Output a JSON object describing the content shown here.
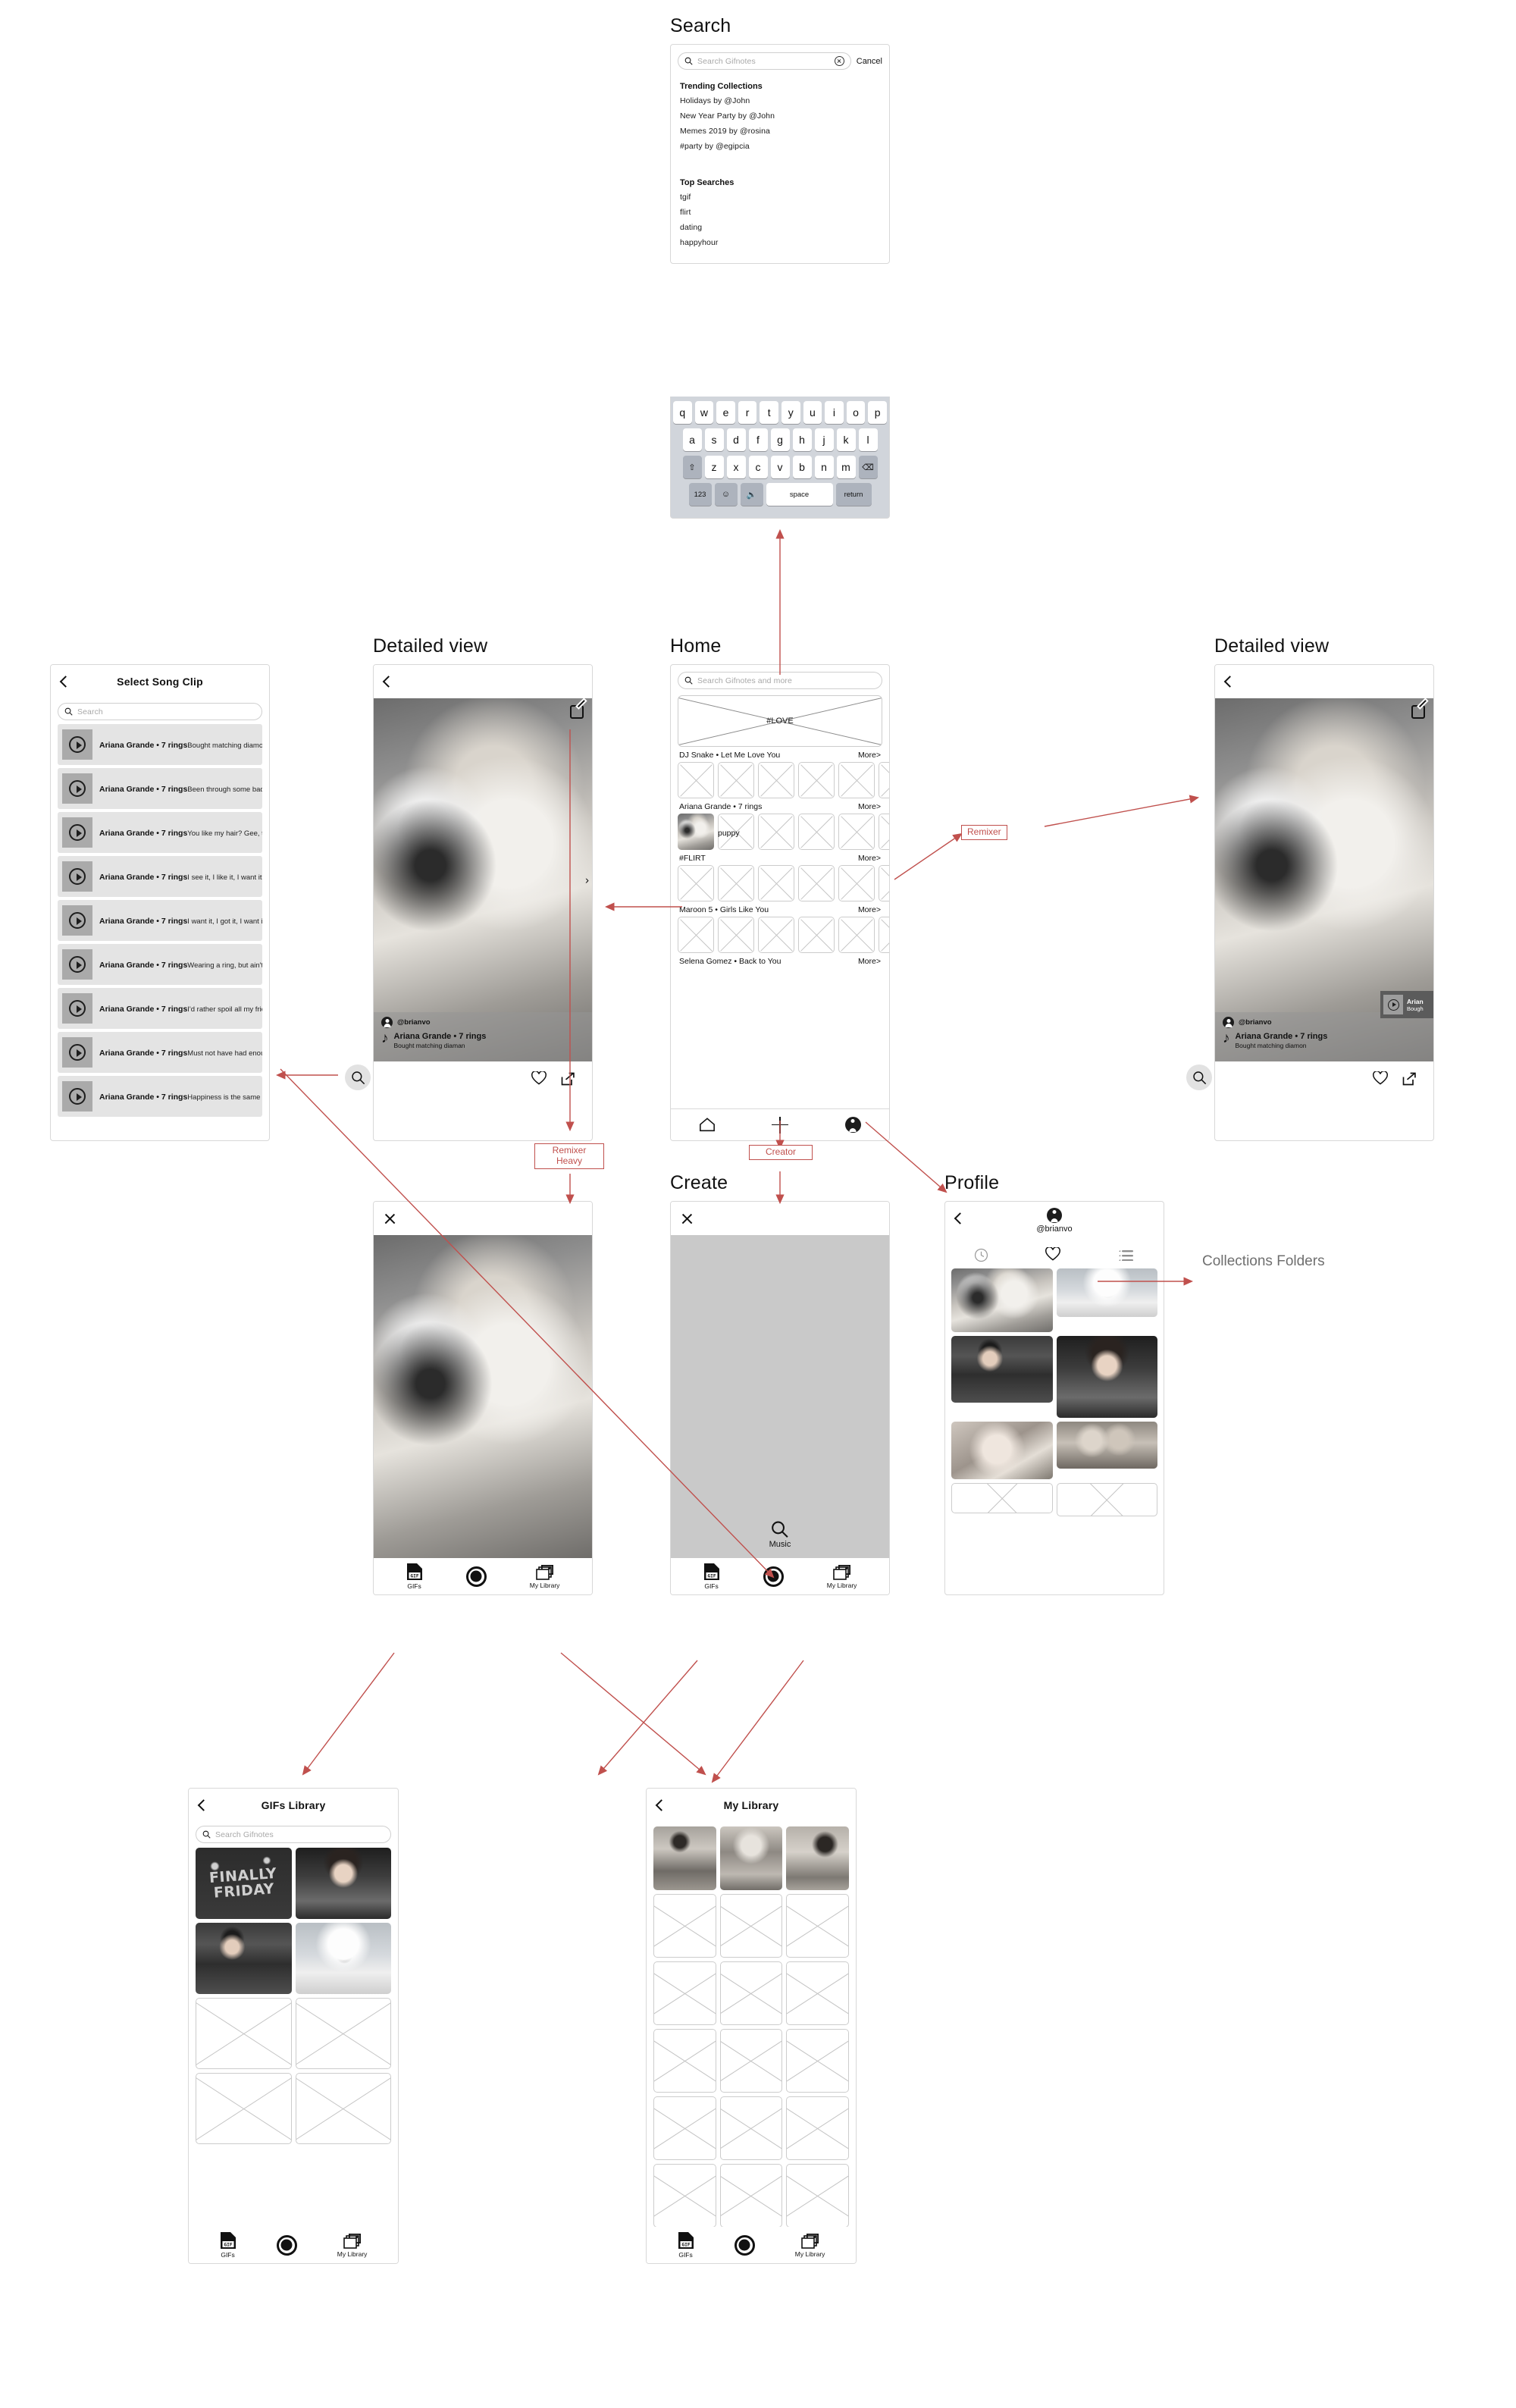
{
  "screens": {
    "search": {
      "label": "Search",
      "search_placeholder": "Search Gifnotes",
      "cancel_label": "Cancel",
      "trending_heading": "Trending Collections",
      "trending": [
        "Holidays by @John",
        "New Year Party by @John",
        "Memes 2019 by @rosina",
        "#party by @egipcia"
      ],
      "top_heading": "Top Searches",
      "top_searches": [
        "tgif",
        "flirt",
        "dating",
        "happyhour"
      ],
      "keyboard": {
        "row1": [
          "q",
          "w",
          "e",
          "r",
          "t",
          "y",
          "u",
          "i",
          "o",
          "p"
        ],
        "row2": [
          "a",
          "s",
          "d",
          "f",
          "g",
          "h",
          "j",
          "k",
          "l"
        ],
        "row3": [
          "⇧",
          "z",
          "x",
          "c",
          "v",
          "b",
          "n",
          "m",
          "⌫"
        ],
        "row4": [
          "123",
          "☺",
          "\u0001",
          "space",
          "return"
        ],
        "numeric_label": "123",
        "space_label": "space",
        "return_label": "return"
      }
    },
    "song_clip": {
      "title": "Select Song Clip",
      "search_placeholder": "Search",
      "items": [
        {
          "title": "Ariana Grande • 7 rings",
          "lyric": "Bought matching diamonds for six of my"
        },
        {
          "title": "Ariana Grande • 7 rings",
          "lyric": "Been through some bad shit, I should be"
        },
        {
          "title": "Ariana Grande • 7 rings",
          "lyric": "You like my hair? Gee, thanks, just"
        },
        {
          "title": "Ariana Grande • 7 rings",
          "lyric": "I see it, I like it, I want it, I got it"
        },
        {
          "title": "Ariana Grande • 7 rings",
          "lyric": "I want it, I got it, I want it, I got it"
        },
        {
          "title": "Ariana Grande • 7 rings",
          "lyric": "Wearing a ring, but ain't gon' be"
        },
        {
          "title": "Ariana Grande • 7 rings",
          "lyric": "I'd rather spoil all my friends with"
        },
        {
          "title": "Ariana Grande • 7 rings",
          "lyric": "Must not have had enough money to"
        },
        {
          "title": "Ariana Grande • 7 rings",
          "lyric": "Happiness is the same price as red-"
        }
      ]
    },
    "detail_left": {
      "label": "Detailed view",
      "handle": "@brianvo",
      "song_title": "Ariana Grande • 7 rings",
      "song_lyric": "Bought matching diaman"
    },
    "detail_right": {
      "label": "Detailed view",
      "handle": "@brianvo",
      "song_title": "Ariana Grande • 7 rings",
      "song_lyric": "Bought matching diamon",
      "mini_card_title": "Arian",
      "mini_card_lyric": "Bough"
    },
    "home": {
      "label": "Home",
      "search_placeholder": "Search Gifnotes and more",
      "hero_label": "#LOVE",
      "puppy_label": "puppy",
      "more_label": "More>",
      "rows": [
        {
          "title": "DJ Snake • Let Me Love You"
        },
        {
          "title": "Ariana Grande • 7 rings"
        },
        {
          "title": "#FLIRT"
        },
        {
          "title": "Maroon 5 • Girls Like You"
        },
        {
          "title": "Selena Gomez • Back to You"
        }
      ]
    },
    "create": {
      "label": "Create",
      "music_label": "Music",
      "tabs": [
        {
          "label": "GIFs",
          "icon": "gif-icon"
        },
        {
          "label": "",
          "icon": "record-icon"
        },
        {
          "label": "My Library",
          "icon": "library-icon"
        }
      ]
    },
    "profile": {
      "label": "Profile",
      "handle": "@brianvo",
      "tabs": [
        "history-icon",
        "heart-icon",
        "list-icon"
      ]
    },
    "gifs_library": {
      "title": "GIFs Library",
      "search_placeholder": "Search Gifnotes",
      "friday_line1": "FINALLY",
      "friday_line2": "FRIDAY",
      "tabs": [
        {
          "label": "GIFs",
          "icon": "gif-icon"
        },
        {
          "label": "",
          "icon": "record-icon"
        },
        {
          "label": "My Library",
          "icon": "library-icon"
        }
      ]
    },
    "my_library": {
      "title": "My Library",
      "tabs": [
        {
          "label": "GIFs",
          "icon": "gif-icon"
        },
        {
          "label": "",
          "icon": "record-icon"
        },
        {
          "label": "My Library",
          "icon": "library-icon"
        }
      ]
    }
  },
  "annotations": {
    "remixer": "Remixer",
    "remixer_heavy": "Remixer\nHeavy",
    "creator": "Creator",
    "collections_folders": "Collections\nFolders",
    "accent_color": "#c0504d"
  }
}
